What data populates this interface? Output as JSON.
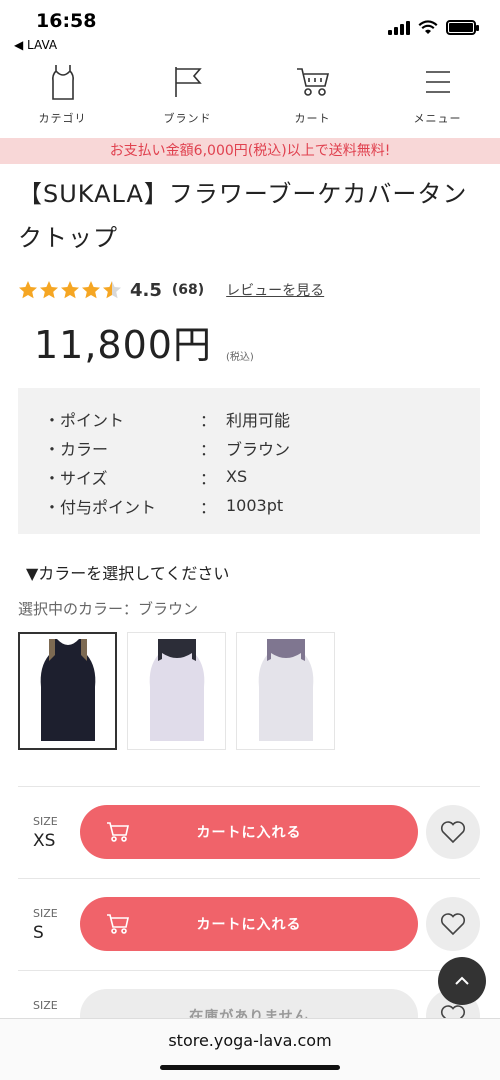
{
  "status_bar": {
    "time": "16:58",
    "back_app": "◀ LAVA"
  },
  "nav": [
    {
      "label": "カテゴリ",
      "icon": "tank-top-icon"
    },
    {
      "label": "ブランド",
      "icon": "flag-icon"
    },
    {
      "label": "カート",
      "icon": "cart-icon"
    },
    {
      "label": "メニュー",
      "icon": "hamburger-menu-icon"
    }
  ],
  "banner": {
    "text": "お支払い金額6,000円(税込)以上で送料無料!"
  },
  "product": {
    "title": "【SUKALA】フラワーブーケカバータンクトップ",
    "rating": {
      "value": "4.5",
      "stars": 4.5,
      "count": "(68)",
      "review_link": "レビューを見る"
    },
    "price": "11,800円",
    "tax_note": "(税込)"
  },
  "info": [
    {
      "key": "・ポイント",
      "sep": "：",
      "value": "利用可能"
    },
    {
      "key": "・カラー",
      "sep": "：",
      "value": "ブラウン"
    },
    {
      "key": "・サイズ",
      "sep": "：",
      "value": "XS"
    },
    {
      "key": "・付与ポイント",
      "sep": "：",
      "value": "1003pt"
    }
  ],
  "color_select": {
    "heading": "▼カラーを選択してください",
    "selected": "選択中のカラー：ブラウン",
    "swatches": [
      {
        "name": "brown",
        "body": "#1d1f2e",
        "strap": "#7d6a52",
        "selected": true
      },
      {
        "name": "lavender",
        "body": "#e0dcea",
        "strap": "#2c2d38",
        "selected": false
      },
      {
        "name": "purple",
        "body": "#e4e3ea",
        "strap": "#7f7690",
        "selected": false
      }
    ]
  },
  "sizes": [
    {
      "label": "SIZE",
      "size": "XS",
      "button": "カートに入れる",
      "available": true
    },
    {
      "label": "SIZE",
      "size": "S",
      "button": "カートに入れる",
      "available": true
    },
    {
      "label": "SIZE",
      "size": "",
      "button": "在庫がありません",
      "available": false
    }
  ],
  "colors": {
    "accent": "#f0636a",
    "banner_bg": "#f8d7d7",
    "banner_text": "#e0414f",
    "star": "#f5a623"
  },
  "url_bar": {
    "url": "store.yoga-lava.com"
  }
}
